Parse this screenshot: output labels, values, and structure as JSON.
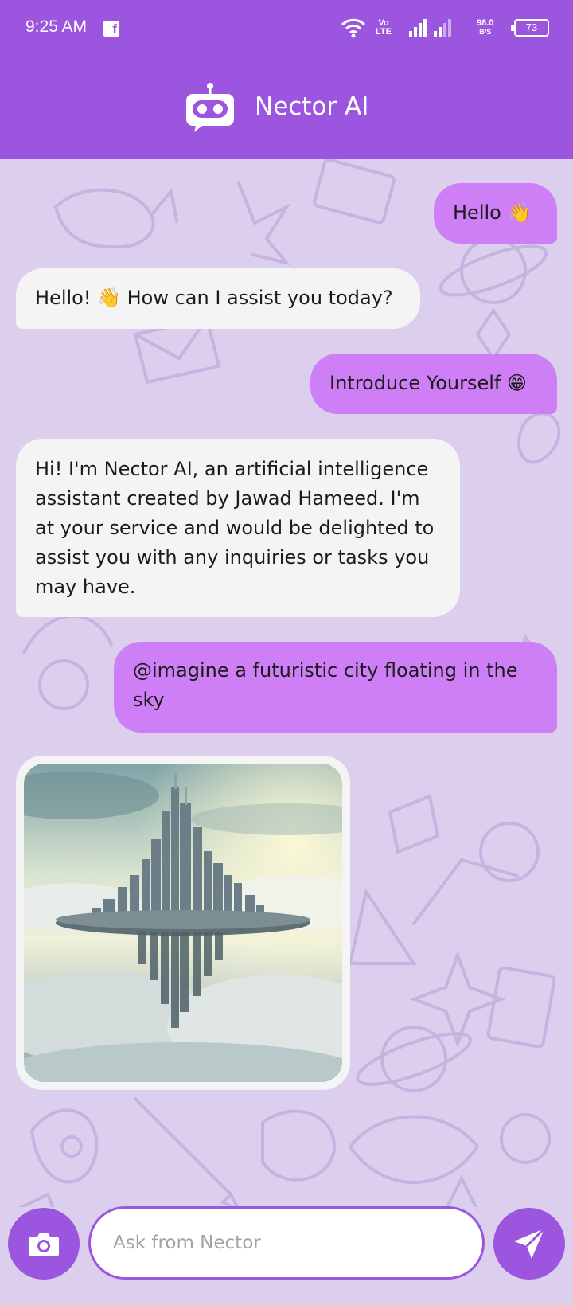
{
  "status_bar": {
    "time": "9:25 AM",
    "volte_top": "Vo",
    "volte_bottom": "LTE",
    "net_speed_value": "98.0",
    "net_speed_unit": "B/S",
    "battery": "73",
    "app_icon": "facebook-icon"
  },
  "header": {
    "title": "Nector AI",
    "logo_icon": "robot-chat-icon"
  },
  "messages": [
    {
      "role": "user",
      "text": "Hello 👋"
    },
    {
      "role": "bot",
      "text": "Hello! 👋 How can I assist you today?"
    },
    {
      "role": "user",
      "text": "Introduce Yourself 😁"
    },
    {
      "role": "bot",
      "text": "Hi! I'm Nector AI, an artificial intelligence assistant created by Jawad Hameed. I'm at your service and would be delighted to assist you with any inquiries or tasks you may have."
    },
    {
      "role": "user",
      "text": "@imagine a futuristic city floating in the sky"
    },
    {
      "role": "bot",
      "type": "image",
      "image": "generated-floating-city-image"
    }
  ],
  "composer": {
    "placeholder": "Ask from Nector",
    "value": "",
    "camera_icon": "camera-icon",
    "send_icon": "send-icon"
  },
  "colors": {
    "accent": "#9c55de",
    "user_bubble": "#cf7ff5",
    "bot_bubble": "#f4f4f4",
    "chat_background": "#dccfee"
  }
}
